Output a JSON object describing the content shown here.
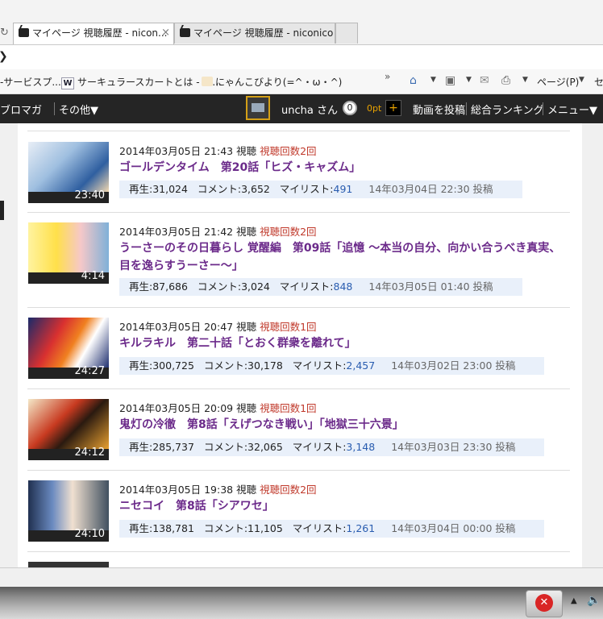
{
  "browser": {
    "reload_icon": "reload-icon",
    "tabs": [
      {
        "label": "マイページ 視聴履歴 - nicon...",
        "close": "×",
        "active": true
      },
      {
        "label": "マイページ 視聴履歴 - niconico",
        "active": false
      }
    ],
    "favorites": [
      {
        "label": "-サービスプ..."
      },
      {
        "label": "サーキュラースカートとは - ア...",
        "icon_text": "W"
      },
      {
        "label": "にゃんこびより(=^・ω・^)"
      }
    ],
    "chevron": "»",
    "page_menu": "ページ(P)",
    "safety_menu": "セ"
  },
  "nav": {
    "items": [
      "ブロマガ",
      "その他▼"
    ],
    "username": "uncha さん",
    "points_count": "0",
    "points_label": "0pt",
    "plus": "+",
    "links": [
      "動画を投稿",
      "総合ランキング",
      "メニュー▼"
    ]
  },
  "history": [
    {
      "date": "2014年03月05日 21:43 視聴",
      "count": "視聴回数2回",
      "title": "ゴールデンタイム　第20話「ヒズ・キャズム」",
      "duration": "23:40",
      "views": "再生:31,024",
      "comments": "コメント:3,652",
      "mylist_label": "マイリスト:",
      "mylist": "491",
      "posted": "14年03月04日 22:30 投稿"
    },
    {
      "date": "2014年03月05日 21:42 視聴",
      "count": "視聴回数2回",
      "title": "うーさーのその日暮らし 覚醒編　第09話「追憶 ～本当の自分、向かい合うべき真実、目を逸らすうーさー～」",
      "duration": "4:14",
      "views": "再生:87,686",
      "comments": "コメント:3,024",
      "mylist_label": "マイリスト:",
      "mylist": "848",
      "posted": "14年03月05日 01:40 投稿"
    },
    {
      "date": "2014年03月05日 20:47 視聴",
      "count": "視聴回数1回",
      "title": "キルラキル　第二十話「とおく群衆を離れて」",
      "duration": "24:27",
      "views": "再生:300,725",
      "comments": "コメント:30,178",
      "mylist_label": "マイリスト:",
      "mylist": "2,457",
      "posted": "14年03月02日 23:00 投稿"
    },
    {
      "date": "2014年03月05日 20:09 視聴",
      "count": "視聴回数1回",
      "title": "鬼灯の冷徹　第8話「えげつなき戦い」「地獄三十六景」",
      "duration": "24:12",
      "views": "再生:285,737",
      "comments": "コメント:32,065",
      "mylist_label": "マイリスト:",
      "mylist": "3,148",
      "posted": "14年03月03日 23:30 投稿"
    },
    {
      "date": "2014年03月05日 19:38 視聴",
      "count": "視聴回数2回",
      "title": "ニセコイ　第8話「シアワセ」",
      "duration": "24:10",
      "views": "再生:138,781",
      "comments": "コメント:11,105",
      "mylist_label": "マイリスト:",
      "mylist": "1,261",
      "posted": "14年03月04日 00:00 投稿"
    }
  ],
  "colors": {
    "nav_bg": "#252525",
    "title": "#6b2a8a",
    "count": "#c0392b",
    "stats_bg": "#e9f0fa",
    "mylist": "#2a5db0"
  }
}
